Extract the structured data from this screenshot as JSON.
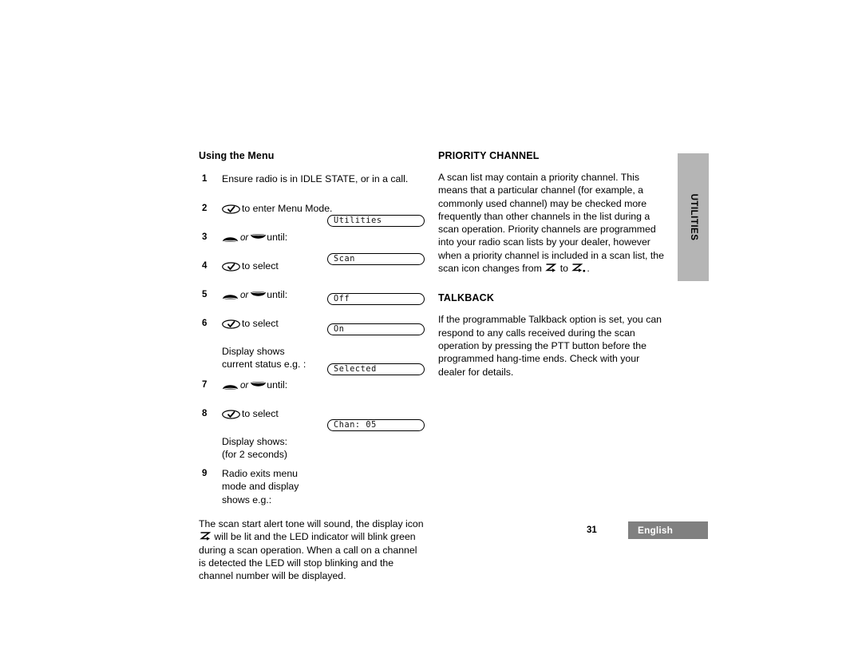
{
  "page": {
    "number": "31",
    "language": "English",
    "side_tab": "UTILITIES"
  },
  "left_column": {
    "heading": "Using the Menu",
    "steps": [
      {
        "num": "1",
        "icon": "none",
        "text": "Ensure radio is in IDLE STATE, or in a call.",
        "lcd": null
      },
      {
        "num": "2",
        "icon": "ok",
        "text": "to enter Menu Mode.",
        "lcd": null
      },
      {
        "num": "3",
        "icon": "updown",
        "text": "until:",
        "lcd": "Utilities"
      },
      {
        "num": "4",
        "icon": "ok",
        "text": "to select",
        "lcd": null
      },
      {
        "num": "5",
        "icon": "updown",
        "text": "until:",
        "lcd": "Scan"
      },
      {
        "num": "6",
        "icon": "ok",
        "text": "to select",
        "lcd": null
      },
      {
        "num": "",
        "icon": "none",
        "text": "Display shows\ncurrent status e.g. :",
        "lcd": "Off"
      },
      {
        "num": "7",
        "icon": "updown",
        "text": "until:",
        "lcd": "On"
      },
      {
        "num": "8",
        "icon": "ok",
        "text": "to select",
        "lcd": null
      },
      {
        "num": "",
        "icon": "none",
        "text": "Display shows:\n(for 2 seconds)",
        "lcd": "Selected"
      },
      {
        "num": "9",
        "icon": "none",
        "text": "Radio exits menu\nmode and display\nshows e.g.:",
        "lcd": "Chan: 05"
      }
    ],
    "or_label": "or",
    "closing_paragraph": {
      "part1": "The scan start alert tone will sound, the display icon",
      "part2": "will be lit and the LED indicator will blink green during a scan operation. When a call on a channel is detected the LED will stop blinking and the channel number will be displayed."
    }
  },
  "right_column": {
    "sections": [
      {
        "heading": "PRIORITY CHANNEL",
        "body_part1": "A scan list may contain a priority channel. This means that a particular channel (for example, a commonly used channel) may be checked more frequently than other channels in the list during a scan operation. Priority channels are programmed into your radio scan lists by your dealer, however when a priority channel is included in a scan list, the scan icon changes from",
        "body_mid": "to",
        "body_end": "."
      },
      {
        "heading": "TALKBACK",
        "body": "If the programmable Talkback option is set, you can respond to any calls received during the scan operation by pressing the PTT button before the programmed hang-time ends. Check with your dealer for details."
      }
    ]
  },
  "colors": {
    "side_tab_bg": "#b5b5b5",
    "footer_bg": "#808080",
    "footer_text": "#ffffff",
    "text": "#000000"
  }
}
